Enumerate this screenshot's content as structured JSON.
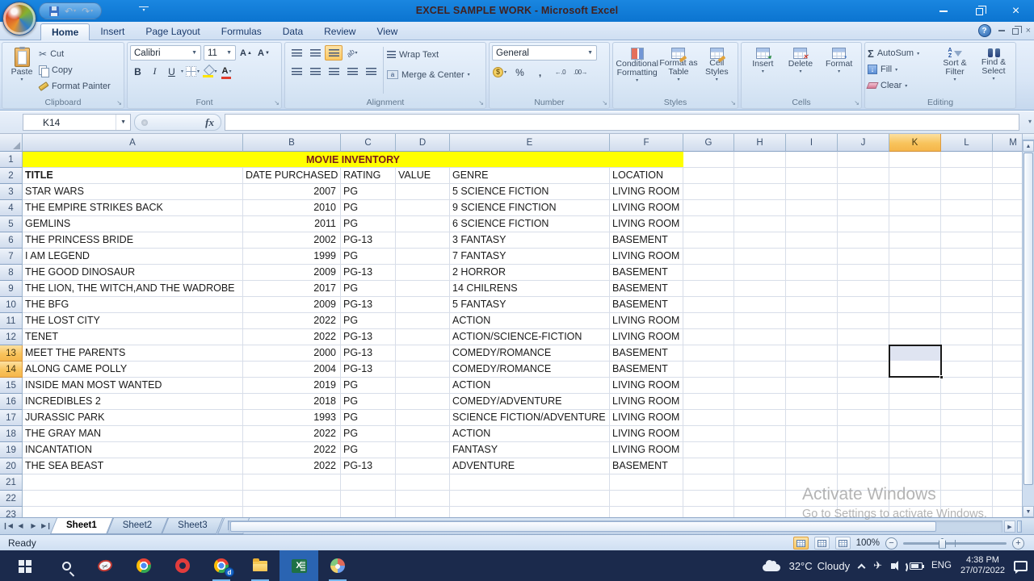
{
  "window": {
    "title": "EXCEL SAMPLE WORK - Microsoft Excel"
  },
  "active_tab": "Home",
  "ribbon_tabs": [
    "Home",
    "Insert",
    "Page Layout",
    "Formulas",
    "Data",
    "Review",
    "View"
  ],
  "ribbon": {
    "clipboard": {
      "label": "Clipboard",
      "paste": "Paste",
      "cut": "Cut",
      "copy": "Copy",
      "format_painter": "Format Painter"
    },
    "font": {
      "label": "Font",
      "font_name": "Calibri",
      "font_size": "11",
      "bold": "B",
      "italic": "I",
      "underline": "U"
    },
    "alignment": {
      "label": "Alignment",
      "wrap_text": "Wrap Text",
      "merge_center": "Merge & Center"
    },
    "number": {
      "label": "Number",
      "format": "General",
      "currency": "$",
      "percent": "%",
      "comma": ",",
      "inc_decimal": "←.0",
      "dec_decimal": ".00→"
    },
    "styles": {
      "label": "Styles",
      "conditional": "Conditional Formatting",
      "as_table": "Format as Table",
      "cell_styles": "Cell Styles"
    },
    "cells": {
      "label": "Cells",
      "insert": "Insert",
      "delete": "Delete",
      "format": "Format"
    },
    "editing": {
      "label": "Editing",
      "autosum": "AutoSum",
      "fill": "Fill",
      "clear": "Clear",
      "sort_filter": "Sort & Filter",
      "find_select": "Find & Select"
    }
  },
  "formula_bar": {
    "name_box": "K14",
    "fx_label": "fx",
    "formula_value": ""
  },
  "sheet": {
    "columns": [
      "A",
      "B",
      "C",
      "D",
      "E",
      "F",
      "G",
      "H",
      "I",
      "J",
      "K",
      "L",
      "M"
    ],
    "row_count": 23,
    "highlighted_column": "K",
    "highlighted_rows": [
      13,
      14
    ],
    "selection": {
      "range": "K13:K14",
      "active_cell": "K14"
    },
    "banner": {
      "text": "MOVIE INVENTORY",
      "background": "#ffff00"
    },
    "header_row": {
      "row": 2,
      "cells": {
        "A": "TITLE",
        "B": "DATE PURCHASED",
        "C": "RATING",
        "D": "VALUE",
        "E": "GENRE",
        "F": "LOCATION"
      }
    },
    "data_rows": [
      {
        "row": 3,
        "A": "STAR WARS",
        "B": "2007",
        "C": "PG",
        "E": "5 SCIENCE FICTION",
        "F": "LIVING ROOM"
      },
      {
        "row": 4,
        "A": "THE EMPIRE STRIKES BACK",
        "B": "2010",
        "C": "PG",
        "E": "9 SCIENCE FINCTION",
        "F": "LIVING ROOM"
      },
      {
        "row": 5,
        "A": "GEMLINS",
        "B": "2011",
        "C": "PG",
        "E": "6 SCIENCE FICTION",
        "F": "LIVING ROOM"
      },
      {
        "row": 6,
        "A": "THE PRINCESS BRIDE",
        "B": "2002",
        "C": "PG-13",
        "E": "3 FANTASY",
        "F": "BASEMENT"
      },
      {
        "row": 7,
        "A": "I AM LEGEND",
        "B": "1999",
        "C": "PG",
        "E": "7 FANTASY",
        "F": "LIVING ROOM"
      },
      {
        "row": 8,
        "A": "THE GOOD DINOSAUR",
        "B": "2009",
        "C": "PG-13",
        "E": "2 HORROR",
        "F": "BASEMENT"
      },
      {
        "row": 9,
        "A": "THE LION, THE WITCH,AND THE WADROBE",
        "B": "2017",
        "C": "PG",
        "E": "14 CHILRENS",
        "F": "BASEMENT"
      },
      {
        "row": 10,
        "A": "THE BFG",
        "B": "2009",
        "C": "PG-13",
        "E": "5 FANTASY",
        "F": "BASEMENT"
      },
      {
        "row": 11,
        "A": "THE LOST CITY",
        "B": "2022",
        "C": "PG",
        "E": "ACTION",
        "F": "LIVING ROOM"
      },
      {
        "row": 12,
        "A": "TENET",
        "B": "2022",
        "C": "PG-13",
        "E": "ACTION/SCIENCE-FICTION",
        "F": "LIVING ROOM"
      },
      {
        "row": 13,
        "A": "MEET THE PARENTS",
        "B": "2000",
        "C": "PG-13",
        "E": "COMEDY/ROMANCE",
        "F": "BASEMENT"
      },
      {
        "row": 14,
        "A": "ALONG CAME POLLY",
        "B": "2004",
        "C": "PG-13",
        "E": "COMEDY/ROMANCE",
        "F": "BASEMENT"
      },
      {
        "row": 15,
        "A": "INSIDE MAN MOST WANTED",
        "B": "2019",
        "C": "PG",
        "E": "ACTION",
        "F": "LIVING ROOM"
      },
      {
        "row": 16,
        "A": "INCREDIBLES 2",
        "B": "2018",
        "C": "PG",
        "E": "COMEDY/ADVENTURE",
        "F": "LIVING ROOM"
      },
      {
        "row": 17,
        "A": "JURASSIC PARK",
        "B": "1993",
        "C": "PG",
        "E": "SCIENCE FICTION/ADVENTURE",
        "F": "LIVING ROOM"
      },
      {
        "row": 18,
        "A": "THE GRAY MAN",
        "B": "2022",
        "C": "PG",
        "E": "ACTION",
        "F": "LIVING ROOM"
      },
      {
        "row": 19,
        "A": "INCANTATION",
        "B": "2022",
        "C": "PG",
        "E": "FANTASY",
        "F": "LIVING ROOM"
      },
      {
        "row": 20,
        "A": "THE SEA BEAST",
        "B": "2022",
        "C": "PG-13",
        "E": "ADVENTURE",
        "F": "BASEMENT"
      }
    ]
  },
  "sheet_tabs": {
    "tabs": [
      "Sheet1",
      "Sheet2",
      "Sheet3"
    ],
    "active": "Sheet1"
  },
  "status_bar": {
    "mode": "Ready",
    "zoom_level": "100%"
  },
  "watermark": {
    "line1": "Activate Windows",
    "line2": "Go to Settings to activate Windows."
  },
  "taskbar": {
    "apps": [
      "start",
      "search",
      "snipping-tool",
      "chrome",
      "opera",
      "chrome-profile",
      "file-explorer",
      "excel",
      "paint"
    ],
    "active_app": "excel",
    "running_apps": [
      "chrome-profile",
      "file-explorer",
      "excel",
      "paint"
    ],
    "chrome_profile_badge": "d",
    "weather": {
      "temp": "32°C",
      "condition": "Cloudy"
    },
    "language": "ENG",
    "clock": {
      "time": "4:38 PM",
      "date": "27/07/2022"
    }
  },
  "colors": {
    "titlebar_blue": "#0b74d0",
    "accent_orange": "#f8c35c",
    "banner_yellow": "#ffff00",
    "taskbar_navy": "#1b2a4c"
  }
}
